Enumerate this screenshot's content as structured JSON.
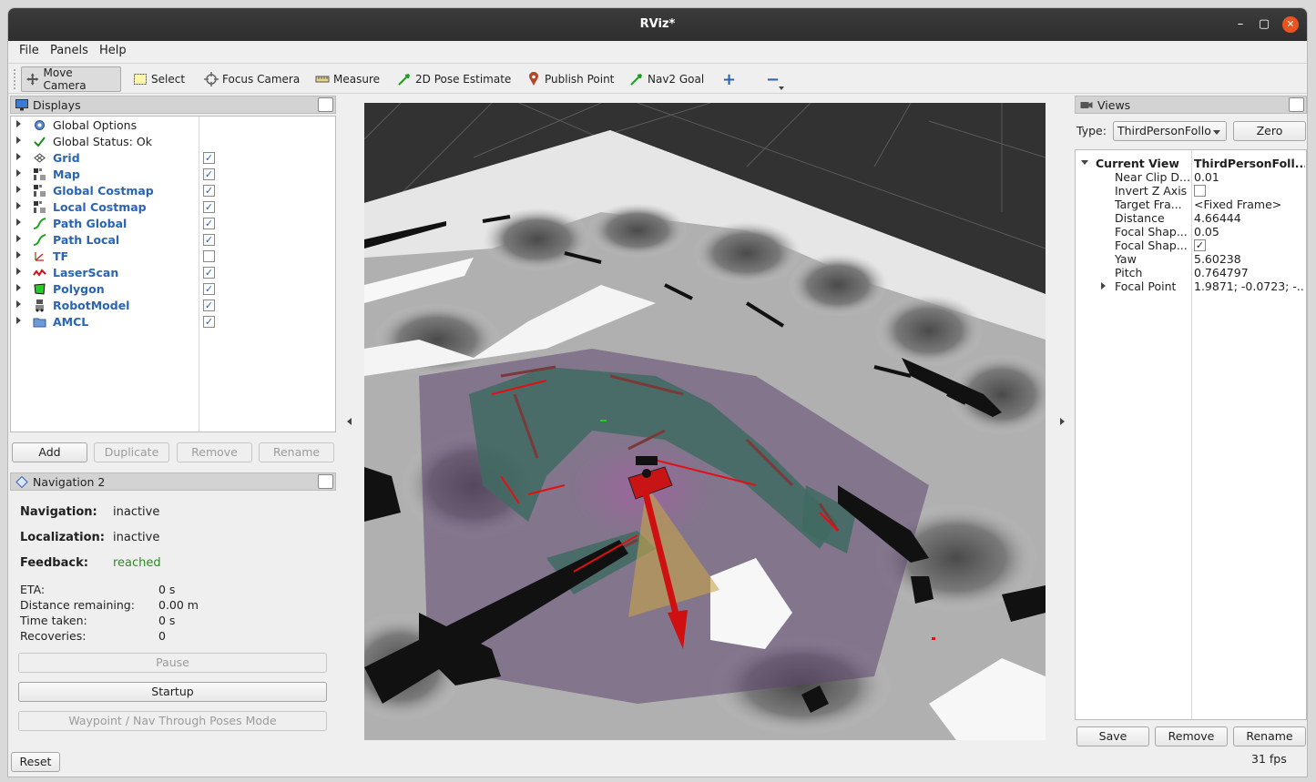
{
  "window": {
    "title": "RViz*"
  },
  "menu": {
    "file": "File",
    "panels": "Panels",
    "help": "Help"
  },
  "toolbar": {
    "move_camera": "Move Camera",
    "select": "Select",
    "focus_camera": "Focus Camera",
    "measure": "Measure",
    "pose_estimate": "2D Pose Estimate",
    "publish_point": "Publish Point",
    "nav2_goal": "Nav2 Goal",
    "add_tool": "+",
    "remove_tool": "−"
  },
  "displays": {
    "title": "Displays",
    "items": [
      {
        "label": "Global Options",
        "icon": "gear-icon",
        "enabled": null
      },
      {
        "label": "Global Status: Ok",
        "icon": "check-icon",
        "enabled": null
      },
      {
        "label": "Grid",
        "icon": "grid-icon",
        "enabled": true
      },
      {
        "label": "Map",
        "icon": "map-icon",
        "enabled": true
      },
      {
        "label": "Global Costmap",
        "icon": "map-icon",
        "enabled": true
      },
      {
        "label": "Local Costmap",
        "icon": "map-icon",
        "enabled": true
      },
      {
        "label": "Path Global",
        "icon": "path-icon",
        "enabled": true
      },
      {
        "label": "Path Local",
        "icon": "path-icon",
        "enabled": true
      },
      {
        "label": "TF",
        "icon": "tf-icon",
        "enabled": false
      },
      {
        "label": "LaserScan",
        "icon": "laserscan-icon",
        "enabled": true
      },
      {
        "label": "Polygon",
        "icon": "polygon-icon",
        "enabled": true
      },
      {
        "label": "RobotModel",
        "icon": "robot-icon",
        "enabled": true
      },
      {
        "label": "AMCL",
        "icon": "folder-icon",
        "enabled": true
      }
    ],
    "buttons": {
      "add": "Add",
      "duplicate": "Duplicate",
      "remove": "Remove",
      "rename": "Rename"
    }
  },
  "navigation": {
    "title": "Navigation 2",
    "navigation_label": "Navigation:",
    "navigation_value": "inactive",
    "localization_label": "Localization:",
    "localization_value": "inactive",
    "feedback_label": "Feedback:",
    "feedback_value": "reached",
    "eta_label": "ETA:",
    "eta_value": "0 s",
    "distance_label": "Distance remaining:",
    "distance_value": "0.00 m",
    "time_label": "Time taken:",
    "time_value": "0 s",
    "recoveries_label": "Recoveries:",
    "recoveries_value": "0",
    "pause": "Pause",
    "startup": "Startup",
    "waypoint": "Waypoint / Nav Through Poses Mode"
  },
  "views": {
    "title": "Views",
    "type_label": "Type:",
    "type_value": "ThirdPersonFollo",
    "zero": "Zero",
    "current_view": "Current View",
    "current_view_type": "ThirdPersonFoll...",
    "props": [
      {
        "key": "Near Clip D...",
        "value": "0.01"
      },
      {
        "key": "Invert Z Axis",
        "value": ""
      },
      {
        "key": "Target Fra...",
        "value": "<Fixed Frame>"
      },
      {
        "key": "Distance",
        "value": "4.66444"
      },
      {
        "key": "Focal Shap...",
        "value": "0.05"
      },
      {
        "key": "Focal Shap...",
        "value": ""
      },
      {
        "key": "Yaw",
        "value": "5.60238"
      },
      {
        "key": "Pitch",
        "value": "0.764797"
      },
      {
        "key": "Focal Point",
        "value": "1.9871; -0.0723; -..."
      }
    ],
    "invert_z_checked": false,
    "focal_shape_fixed_checked": true,
    "buttons": {
      "save": "Save",
      "remove": "Remove",
      "rename": "Rename"
    }
  },
  "status": {
    "reset": "Reset",
    "fps": "31 fps"
  },
  "colors": {
    "accent_blue": "#2a64b4",
    "feedback_green": "#2e8b22",
    "robot_red": "#d01010"
  }
}
